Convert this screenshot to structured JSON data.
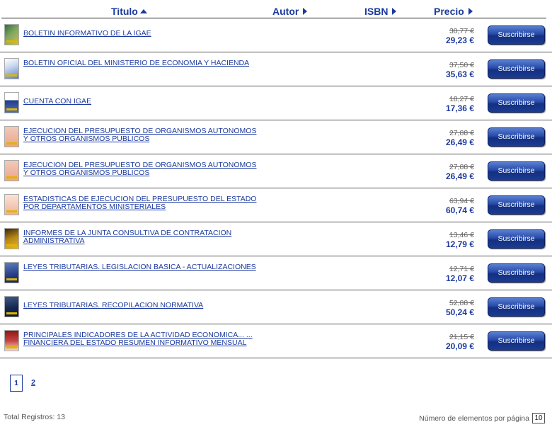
{
  "header": {
    "titulo": "Titulo",
    "autor": "Autor",
    "isbn": "ISBN",
    "precio": "Precio"
  },
  "subscribe_label": "Suscribirse",
  "rows": [
    {
      "title": "BOLETIN INFORMATIVO DE LA IGAE",
      "old_price": "30,77 €",
      "new_price": "29,23 €",
      "thumb": "green"
    },
    {
      "title": "BOLETIN OFICIAL DEL MINISTERIO DE ECONOMIA Y HACIENDA",
      "old_price": "37,50 €",
      "new_price": "35,63 €",
      "thumb": "blue"
    },
    {
      "title": "CUENTA CON IGAE",
      "old_price": "18,27 €",
      "new_price": "17,36 €",
      "thumb": "igae"
    },
    {
      "title": "EJECUCION DEL PRESUPUESTO DE ORGANISMOS AUTONOMOS Y OTROS ORGANISMOS PUBLICOS",
      "old_price": "27,88 €",
      "new_price": "26,49 €",
      "thumb": "pink"
    },
    {
      "title": "EJECUCION DEL PRESUPUESTO DE ORGANISMOS AUTONOMOS Y OTROS ORGANISMOS PUBLICOS",
      "old_price": "27,88 €",
      "new_price": "26,49 €",
      "thumb": "pink"
    },
    {
      "title": "ESTADISTICAS DE EJECUCION DEL PRESUPUESTO DEL ESTADO POR DEPARTAMENTOS MINISTERIALES",
      "old_price": "63,94 €",
      "new_price": "60,74 €",
      "thumb": "pink2"
    },
    {
      "title": "INFORMES DE LA JUNTA CONSULTIVA DE CONTRATACION ADMINISTRATIVA",
      "old_price": "13,46 €",
      "new_price": "12,79 €",
      "thumb": "gold"
    },
    {
      "title": "LEYES TRIBUTARIAS. LEGISLACION BASICA - ACTUALIZACIONES",
      "old_price": "12,71 €",
      "new_price": "12,07 €",
      "thumb": "navy"
    },
    {
      "title": "LEYES TRIBUTARIAS. RECOPILACION NORMATIVA",
      "old_price": "52,88 €",
      "new_price": "50,24 €",
      "thumb": "dark"
    },
    {
      "title": "PRINCIPALES INDICADORES DE LA ACTIVIDAD ECONOMICA... ... FINANCIERA DEL ESTADO RESUMEN INFORMATIVO MENSUAL",
      "old_price": "21,15 €",
      "new_price": "20,09 €",
      "thumb": "red"
    }
  ],
  "pagination": {
    "current": "1",
    "other": "2"
  },
  "footer": {
    "total": "Total Registros: 13",
    "per_page_label": "Número de elementos por página",
    "per_page_value": "10"
  }
}
